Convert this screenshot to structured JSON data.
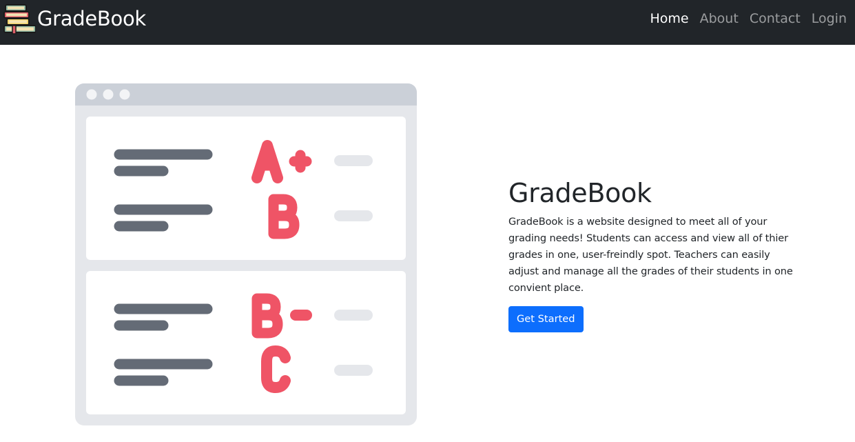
{
  "brand": {
    "name": "GradeBook",
    "logo_icon": "stacked-books-icon"
  },
  "nav": {
    "items": [
      {
        "label": "Home",
        "active": true
      },
      {
        "label": "About",
        "active": false
      },
      {
        "label": "Contact",
        "active": false
      },
      {
        "label": "Login",
        "active": false
      }
    ]
  },
  "illustration": {
    "grades": [
      "A+",
      "B",
      "B-",
      "C"
    ],
    "grade_color": "#ef5466"
  },
  "hero": {
    "title": "GradeBook",
    "description": "GradeBook is a website designed to meet all of your grading needs! Students can access and view all of thier grades in one, user-freindly spot. Teachers can easily adjust and manage all the grades of their students in one convient place.",
    "button_label": "Get Started"
  },
  "colors": {
    "navbar": "#212529",
    "primary": "#0d6efd",
    "grade": "#ef5466"
  }
}
